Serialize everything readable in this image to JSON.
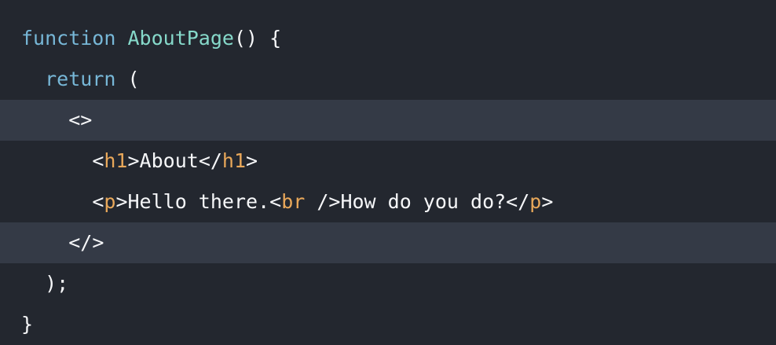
{
  "colors": {
    "background": "#23272f",
    "highlight": "#343a46",
    "keyword": "#77b7d7",
    "function_name": "#86d9ca",
    "tag_name": "#e9a85a",
    "plain": "#f6f7f9"
  },
  "code": {
    "line1": {
      "kw": "function",
      "sp": " ",
      "fn": "AboutPage",
      "rest": "() {"
    },
    "line2": {
      "indent": "  ",
      "kw": "return",
      "rest": " ("
    },
    "line3": {
      "indent": "    ",
      "text": "<>"
    },
    "line4": {
      "indent": "      ",
      "open_lt": "<",
      "open_tag": "h1",
      "open_gt": ">",
      "text": "About",
      "close_lt": "</",
      "close_tag": "h1",
      "close_gt": ">"
    },
    "line5": {
      "indent": "      ",
      "open_lt": "<",
      "open_tag": "p",
      "open_gt": ">",
      "text1": "Hello there.",
      "br_lt": "<",
      "br_tag": "br",
      "br_rest": " />",
      "text2": "How do you do?",
      "close_lt": "</",
      "close_tag": "p",
      "close_gt": ">"
    },
    "line6": {
      "indent": "    ",
      "text": "</>"
    },
    "line7": {
      "indent": "  ",
      "text": ");"
    },
    "line8": {
      "text": "}"
    }
  }
}
